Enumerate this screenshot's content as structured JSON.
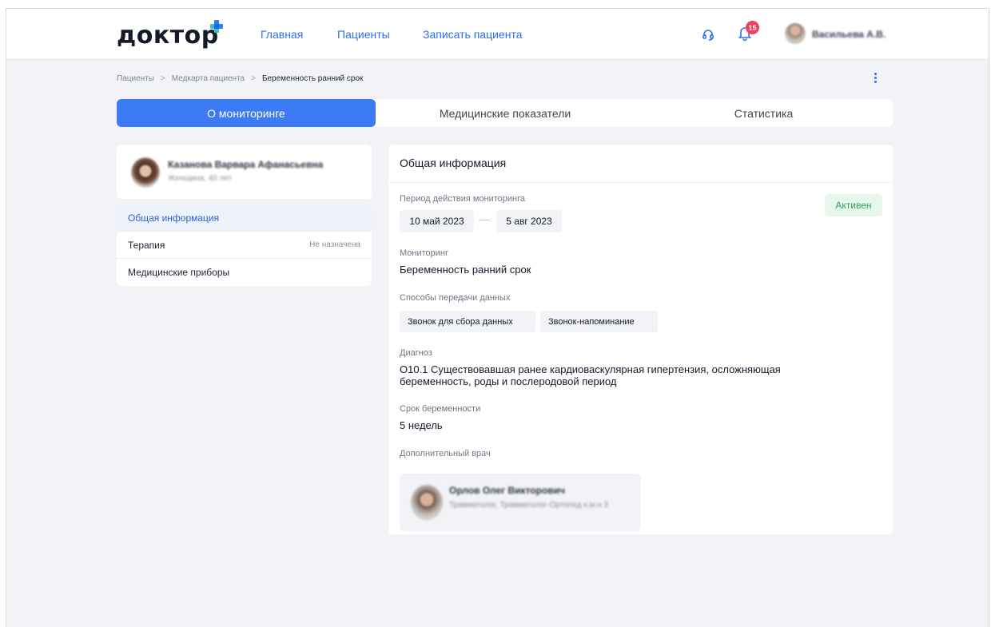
{
  "header": {
    "logo": "доктор",
    "nav": [
      "Главная",
      "Пациенты",
      "Записать пациента"
    ],
    "notifications_count": "15",
    "user_name": "Васильева А.В."
  },
  "breadcrumb": [
    "Пациенты",
    "Медкарта пациента",
    "Беременность ранний срок"
  ],
  "breadcrumb_separator": ">",
  "tabs": [
    "О мониторинге",
    "Медицинские показатели",
    "Статистика"
  ],
  "patient": {
    "name": "Казанова Варвара Афанасьевна",
    "meta": "Женщина, 40 лет"
  },
  "side_menu": [
    {
      "label": "Общая информация",
      "note": ""
    },
    {
      "label": "Терапия",
      "note": "Не назначена"
    },
    {
      "label": "Медицинские приборы",
      "note": ""
    }
  ],
  "main": {
    "title": "Общая информация",
    "status": "Активен",
    "period_label": "Период действия мониторинга",
    "date_from": "10 май 2023",
    "date_to": "5 авг 2023",
    "monitoring_label": "Мониторинг",
    "monitoring_value": "Беременность ранний срок",
    "channels_label": "Способы передачи данных",
    "channels": [
      "Звонок для сбора данных",
      "Звонок-напоминание"
    ],
    "diagnosis_label": "Диагноз",
    "diagnosis_line1": "O10.1 Существовавшая ранее кардиоваскулярная гипертензия, осложняющая",
    "diagnosis_line2": "беременность, роды и послеродовой период",
    "term_label": "Срок беременности",
    "term_value": "5 недель",
    "extra_doctor_label": "Дополнительный врач",
    "doctor_name": "Орлов Олег Викторович",
    "doctor_spec": "Травматолог, Травматолог-Ортопед к.м.н 3"
  },
  "colors": {
    "accent": "#3d7af6",
    "link": "#2f6ef0",
    "badge": "#f0405b",
    "status_bg": "#e7f7ec",
    "status_text": "#2f9e5b"
  }
}
